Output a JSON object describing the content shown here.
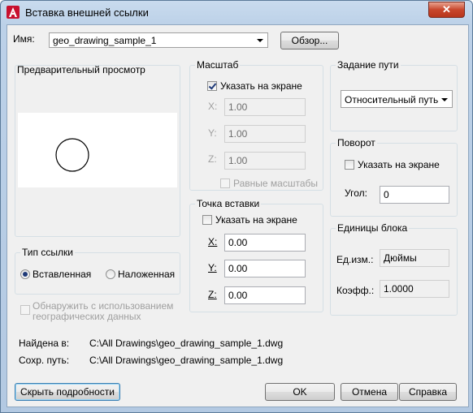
{
  "window": {
    "title": "Вставка внешней ссылки",
    "close_symbol": "✕"
  },
  "name_row": {
    "label": "Имя:",
    "value": "geo_drawing_sample_1",
    "browse_button": "Обзор..."
  },
  "preview": {
    "title": "Предварительный просмотр"
  },
  "scale": {
    "title": "Масштаб",
    "specify_on_screen": "Указать на экране",
    "specify_checked": true,
    "x_label": "X:",
    "x_value": "1.00",
    "y_label": "Y:",
    "y_value": "1.00",
    "z_label": "Z:",
    "z_value": "1.00",
    "uniform_scale": "Равные масштабы"
  },
  "path_type": {
    "title": "Задание пути",
    "value": "Относительный путь"
  },
  "rotation": {
    "title": "Поворот",
    "specify_on_screen": "Указать на экране",
    "angle_label": "Угол:",
    "angle_value": "0"
  },
  "insertion_point": {
    "title": "Точка вставки",
    "specify_on_screen": "Указать на экране",
    "x_label": "X:",
    "x_value": "0.00",
    "y_label": "Y:",
    "y_value": "0.00",
    "z_label": "Z:",
    "z_value": "0.00"
  },
  "block_units": {
    "title": "Единицы блока",
    "unit_label": "Ед.изм.:",
    "unit_value": "Дюймы",
    "factor_label": "Коэфф.:",
    "factor_value": "1.0000"
  },
  "reference_type": {
    "title": "Тип ссылки",
    "attachment": "Вставленная",
    "overlay": "Наложенная",
    "selected": "attachment"
  },
  "geolocate": {
    "line1": "Обнаружить с использованием",
    "line2": "географических данных"
  },
  "found_in": {
    "label": "Найдена в:",
    "value": "C:\\All Drawings\\geo_drawing_sample_1.dwg"
  },
  "saved_path": {
    "label": "Сохр. путь:",
    "value": "C:\\All Drawings\\geo_drawing_sample_1.dwg"
  },
  "buttons": {
    "hide_details": "Скрыть подробности",
    "ok": "OK",
    "cancel": "Отмена",
    "help": "Справка"
  },
  "colors": {
    "accent_blue": "#3c7fb1",
    "close_red": "#c8472c",
    "check_mark": "#1f3a78"
  }
}
